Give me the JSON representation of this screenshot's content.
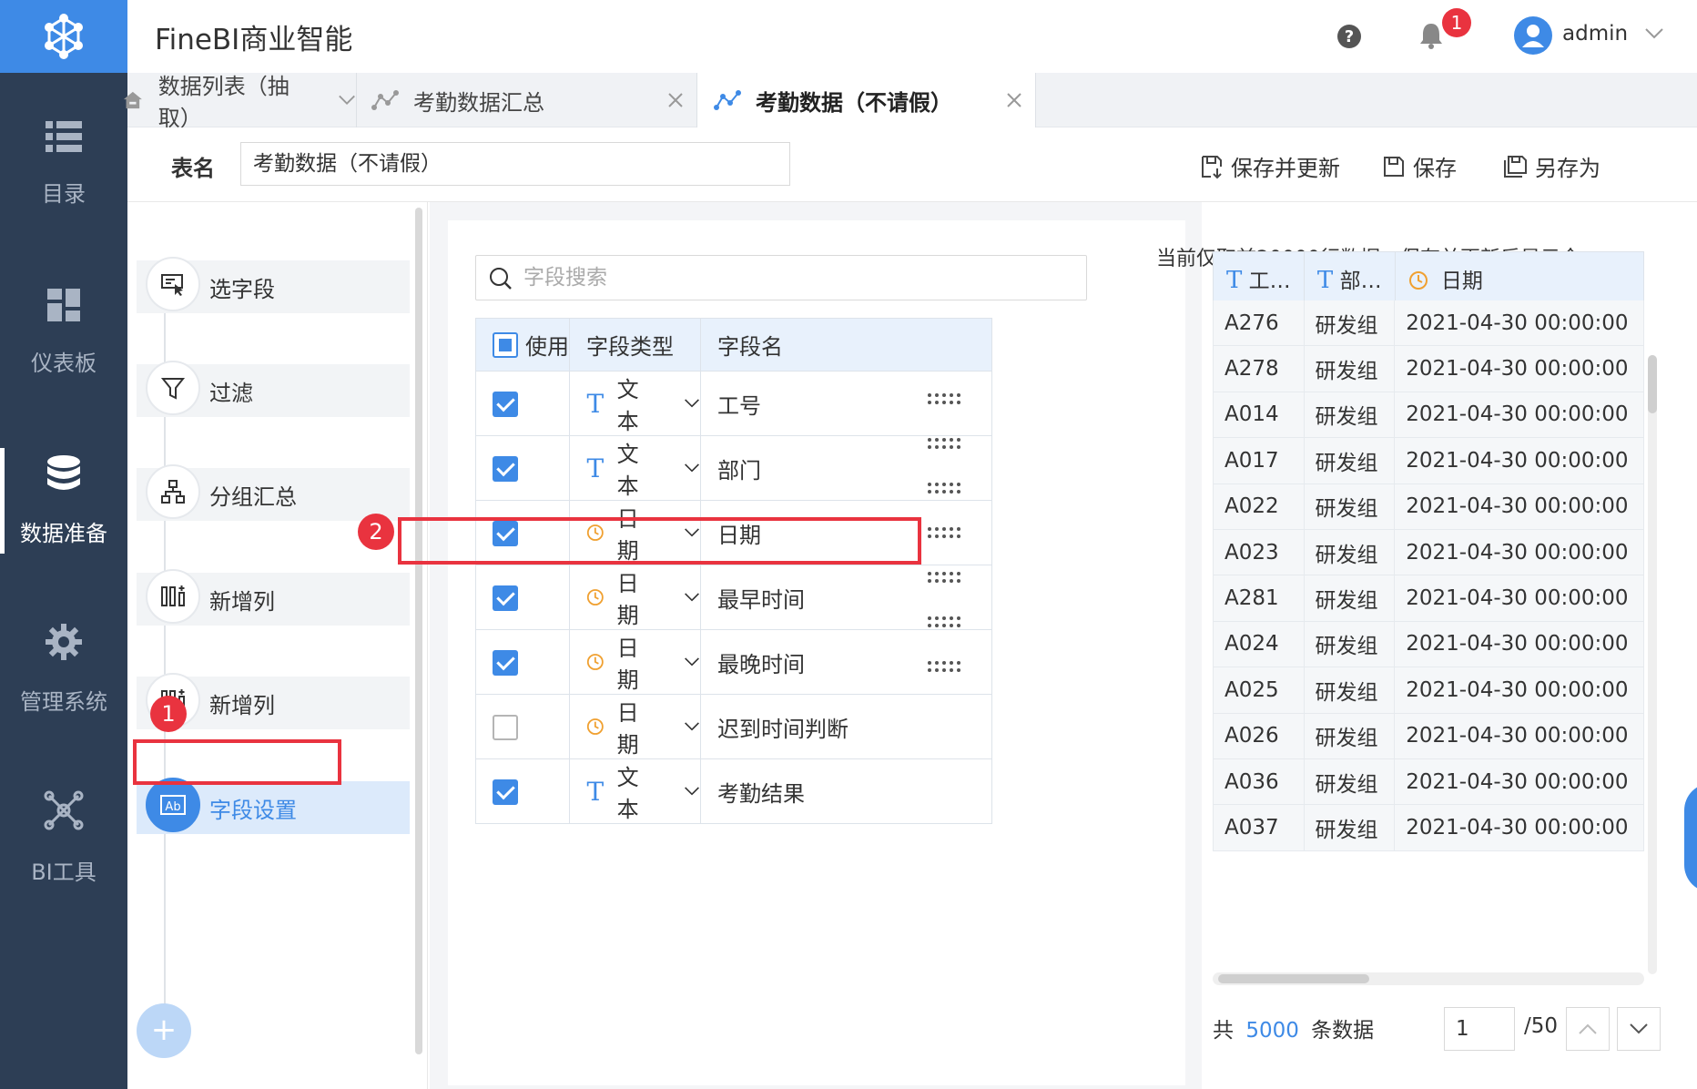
{
  "header": {
    "app_title": "FineBI商业智能",
    "notification_count": "1",
    "user_name": "admin"
  },
  "nav": [
    {
      "label": "目录",
      "icon": "list-icon",
      "active": false
    },
    {
      "label": "仪表板",
      "icon": "dashboard-icon",
      "active": false
    },
    {
      "label": "数据准备",
      "icon": "database-icon",
      "active": true
    },
    {
      "label": "管理系统",
      "icon": "gear-icon",
      "active": false
    },
    {
      "label": "BI工具",
      "icon": "bi-tool-icon",
      "active": false
    }
  ],
  "tabs": [
    {
      "label": "数据列表（抽取）",
      "icon": "home-icon"
    },
    {
      "label": "考勤数据汇总",
      "icon": "dataset-icon"
    },
    {
      "label": "考勤数据（不请假）",
      "icon": "dataset-icon",
      "active": true
    }
  ],
  "toolbar": {
    "table_name_label": "表名",
    "table_name_value": "考勤数据（不请假）",
    "save_update": "保存并更新",
    "save": "保存",
    "save_as": "另存为"
  },
  "steps": [
    {
      "label": "选字段",
      "icon": "select-field-icon"
    },
    {
      "label": "过滤",
      "icon": "filter-icon"
    },
    {
      "label": "分组汇总",
      "icon": "group-icon"
    },
    {
      "label": "新增列",
      "icon": "add-column-icon"
    },
    {
      "label": "新增列",
      "icon": "add-column-icon"
    },
    {
      "label": "字段设置",
      "icon": "field-settings-icon",
      "active": true
    }
  ],
  "markers": {
    "one": "1",
    "two": "2"
  },
  "search": {
    "placeholder": "字段搜索"
  },
  "field_table": {
    "headers": {
      "use": "使用",
      "type": "字段类型",
      "name": "字段名"
    },
    "rows": [
      {
        "checked": true,
        "type_icon": "text-type-icon",
        "type": "文本",
        "name": "工号"
      },
      {
        "checked": true,
        "type_icon": "text-type-icon",
        "type": "文本",
        "name": "部门"
      },
      {
        "checked": true,
        "type_icon": "date-type-icon",
        "type": "日期",
        "name": "日期"
      },
      {
        "checked": true,
        "type_icon": "date-type-icon",
        "type": "日期",
        "name": "最早时间"
      },
      {
        "checked": true,
        "type_icon": "date-type-icon",
        "type": "日期",
        "name": "最晚时间"
      },
      {
        "checked": false,
        "type_icon": "date-type-icon",
        "type": "日期",
        "name": "迟到时间判断"
      },
      {
        "checked": true,
        "type_icon": "text-type-icon",
        "type": "文本",
        "name": "考勤结果"
      }
    ]
  },
  "preview": {
    "note": "当前仅取前20000行数据，保存并更新后显示全…",
    "headers": [
      "工…",
      "部…",
      "日期"
    ],
    "rows": [
      [
        "A276",
        "研发组",
        "2021-04-30 00:00:00"
      ],
      [
        "A278",
        "研发组",
        "2021-04-30 00:00:00"
      ],
      [
        "A014",
        "研发组",
        "2021-04-30 00:00:00"
      ],
      [
        "A017",
        "研发组",
        "2021-04-30 00:00:00"
      ],
      [
        "A022",
        "研发组",
        "2021-04-30 00:00:00"
      ],
      [
        "A023",
        "研发组",
        "2021-04-30 00:00:00"
      ],
      [
        "A281",
        "研发组",
        "2021-04-30 00:00:00"
      ],
      [
        "A024",
        "研发组",
        "2021-04-30 00:00:00"
      ],
      [
        "A025",
        "研发组",
        "2021-04-30 00:00:00"
      ],
      [
        "A026",
        "研发组",
        "2021-04-30 00:00:00"
      ],
      [
        "A036",
        "研发组",
        "2021-04-30 00:00:00"
      ],
      [
        "A037",
        "研发组",
        "2021-04-30 00:00:00"
      ]
    ],
    "pager": {
      "prefix": "共",
      "count": "5000",
      "suffix": "条数据",
      "page": "1",
      "total": "/50"
    }
  },
  "colors": {
    "accent": "#3e8ae6",
    "nav_bg": "#2d3e55",
    "marker_red": "#e9333f",
    "date_icon": "#f0a030"
  }
}
